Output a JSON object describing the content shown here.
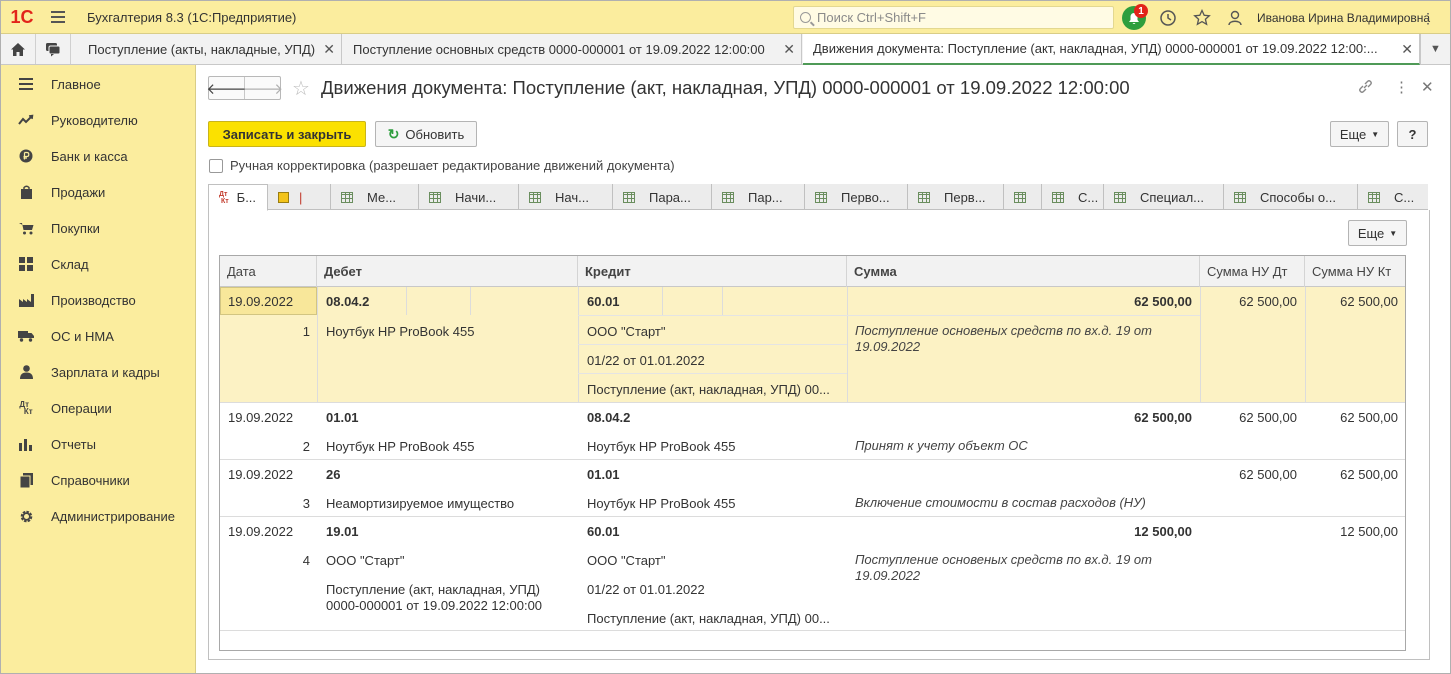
{
  "topbar": {
    "logo": "1С",
    "app_title": "Бухгалтерия 8.3  (1С:Предприятие)",
    "search_placeholder": "Поиск Ctrl+Shift+F",
    "notifications_count": "1",
    "user_name": "Иванова Ирина Владимировна"
  },
  "tabs": [
    {
      "label": "Поступление (акты, накладные, УПД)"
    },
    {
      "label": "Поступление основных средств 0000-000001 от 19.09.2022 12:00:00"
    },
    {
      "label": "Движения документа: Поступление (акт, накладная, УПД) 0000-000001 от 19.09.2022 12:00:..."
    }
  ],
  "sidebar": {
    "items": [
      {
        "label": "Главное",
        "icon": "menu-icon"
      },
      {
        "label": "Руководителю",
        "icon": "chart-line-icon"
      },
      {
        "label": "Банк и касса",
        "icon": "ruble-icon"
      },
      {
        "label": "Продажи",
        "icon": "shopping-bag-icon"
      },
      {
        "label": "Покупки",
        "icon": "cart-icon"
      },
      {
        "label": "Склад",
        "icon": "warehouse-icon"
      },
      {
        "label": "Производство",
        "icon": "factory-icon"
      },
      {
        "label": "ОС и НМА",
        "icon": "truck-icon"
      },
      {
        "label": "Зарплата и кадры",
        "icon": "person-icon"
      },
      {
        "label": "Операции",
        "icon": "dt-kt-icon"
      },
      {
        "label": "Отчеты",
        "icon": "bar-chart-icon"
      },
      {
        "label": "Справочники",
        "icon": "book-icon"
      },
      {
        "label": "Администрирование",
        "icon": "gear-icon"
      }
    ]
  },
  "document": {
    "title": "Движения документа: Поступление (акт, накладная, УПД) 0000-000001 от 19.09.2022 12:00:00",
    "save_close_label": "Записать и закрыть",
    "refresh_label": "Обновить",
    "more_label": "Еще",
    "help_label": "?",
    "manual_correction_label": "Ручная корректировка (разрешает редактирование движений документа)",
    "table_more_label": "Еще"
  },
  "inner_tabs": [
    {
      "label": "Б..."
    },
    {
      "label": ""
    },
    {
      "label": "Ме..."
    },
    {
      "label": "Начи..."
    },
    {
      "label": "Нач..."
    },
    {
      "label": "Пара..."
    },
    {
      "label": "Пар..."
    },
    {
      "label": "Перво..."
    },
    {
      "label": "Перв..."
    },
    {
      "label": ""
    },
    {
      "label": "С..."
    },
    {
      "label": "Специал..."
    },
    {
      "label": "Способы о..."
    },
    {
      "label": "С..."
    }
  ],
  "table": {
    "headers": {
      "date": "Дата",
      "debit": "Дебет",
      "credit": "Кредит",
      "sum": "Сумма",
      "nu_dt": "Сумма НУ Дт",
      "nu_kt": "Сумма НУ Кт"
    },
    "rows": [
      {
        "date": "19.09.2022",
        "n": "1",
        "debit_acc": "08.04.2",
        "debit_sub1": "Ноутбук HP ProBook 455",
        "credit_acc": "60.01",
        "credit_sub1": "ООО \"Старт\"",
        "credit_sub2": "01/22 от 01.01.2022",
        "credit_sub3": "Поступление (акт, накладная, УПД) 00...",
        "sum": "62 500,00",
        "comment": "Поступление основеных средств по вх.д. 19 от 19.09.2022",
        "nu_dt": "62 500,00",
        "nu_kt": "62 500,00"
      },
      {
        "date": "19.09.2022",
        "n": "2",
        "debit_acc": "01.01",
        "debit_sub1": "Ноутбук HP ProBook 455",
        "credit_acc": "08.04.2",
        "credit_sub1": "Ноутбук HP ProBook 455",
        "sum": "62 500,00",
        "comment": "Принят к учету объект ОС",
        "nu_dt": "62 500,00",
        "nu_kt": "62 500,00"
      },
      {
        "date": "19.09.2022",
        "n": "3",
        "debit_acc": "26",
        "debit_sub1": "Неамортизируемое имущество",
        "credit_acc": "01.01",
        "credit_sub1": "Ноутбук HP ProBook 455",
        "sum": "",
        "comment": "Включение стоимости в состав расходов (НУ)",
        "nu_dt": "62 500,00",
        "nu_kt": "62 500,00"
      },
      {
        "date": "19.09.2022",
        "n": "4",
        "debit_acc": "19.01",
        "debit_sub1": "ООО \"Старт\"",
        "debit_sub2": "Поступление (акт, накладная, УПД) 0000-000001 от 19.09.2022 12:00:00",
        "credit_acc": "60.01",
        "credit_sub1": "ООО \"Старт\"",
        "credit_sub2": "01/22 от 01.01.2022",
        "credit_sub3": "Поступление (акт, накладная, УПД) 00...",
        "sum": "12 500,00",
        "comment": "Поступление основеных средств по вх.д. 19 от 19.09.2022",
        "nu_dt": "",
        "nu_kt": "12 500,00"
      }
    ]
  }
}
